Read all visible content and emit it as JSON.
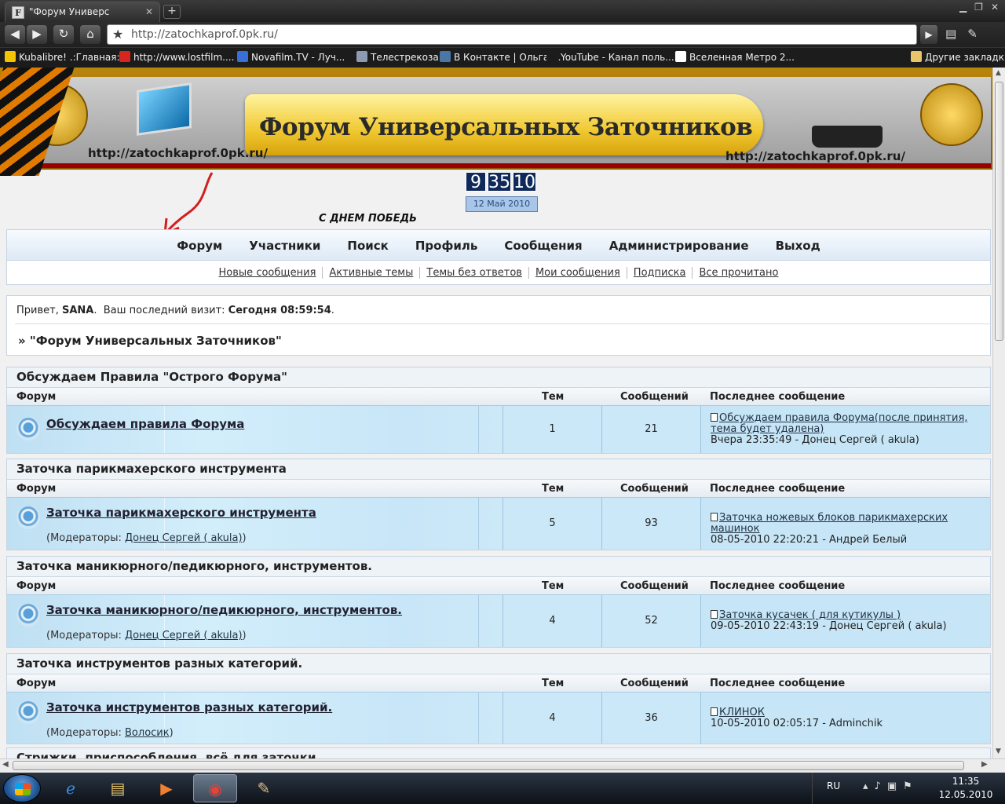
{
  "browser": {
    "tab_title": "\"Форум Универс",
    "tab_favicon": "F",
    "url": "http://zatochkaprof.0pk.ru/",
    "bookmarks": [
      {
        "label": "Kubalibre! .:Главная:.",
        "icon": "star-icon",
        "color": "#f5c400"
      },
      {
        "label": "http://www.lostfilm....",
        "icon": "lf-icon",
        "color": "#d7261e"
      },
      {
        "label": "Novafilm.TV - Луч...",
        "icon": "film-icon",
        "color": "#3a6fd8"
      },
      {
        "label": "Телестрекоза",
        "icon": "tv-icon",
        "color": "#8c9bb0"
      },
      {
        "label": "В Контакте | Ольга ...",
        "icon": "vk-icon",
        "color": "#4b76a8"
      },
      {
        "label": "YouTube - Канал поль...",
        "icon": "youtube-icon",
        "color": "#1c1c1c"
      },
      {
        "label": "Вселенная Метро 2...",
        "icon": "page-icon",
        "color": "#ffffff"
      }
    ],
    "other_bookmarks": "Другие закладки"
  },
  "banner": {
    "title": "Форум Универсальных Заточников",
    "url_left": "http://zatochkaprof.0pk.ru/",
    "url_right": "http://zatochkaprof.0pk.ru/"
  },
  "clock": {
    "digits": [
      "9",
      "35",
      "10"
    ],
    "date": "12 Май 2010"
  },
  "greeting_banner": "С ДНЕМ ПОБЕДЬ",
  "nav": {
    "main": [
      "Форум",
      "Участники",
      "Поиск",
      "Профиль",
      "Сообщения",
      "Администрирование",
      "Выход"
    ],
    "sub": [
      "Новые сообщения",
      "Активные темы",
      "Темы без ответов",
      "Мои сообщения",
      "Подписка",
      "Все прочитано"
    ]
  },
  "welcome": {
    "hello": "Привет,",
    "user": "SANA",
    "last_visit_label": "Ваш последний визит:",
    "last_visit_value": "Сегодня 08:59:54",
    "breadcrumb": "» \"Форум Универсальных Заточников\""
  },
  "table_headers": {
    "forum": "Форум",
    "topics": "Тем",
    "posts": "Сообщений",
    "last": "Последнее сообщение"
  },
  "moderators_label": "(Модераторы:",
  "categories": [
    {
      "title": "Обсуждаем Правила \"Острого Форума\"",
      "forum": "Обсуждаем правила Форума",
      "moderator": "",
      "topics": "1",
      "posts": "21",
      "last_topic": "Обсуждаем правила Форума(после принятия, тема будет удалена)",
      "last_meta": "Вчера 23:35:49 - Донец Сергей ( akula)"
    },
    {
      "title": "Заточка парикмахерского инструмента",
      "forum": "Заточка парикмахерского инструмента",
      "moderator": "Донец Сергей ( akula)",
      "topics": "5",
      "posts": "93",
      "last_topic": "Заточка ножевых блоков парикмахерских машинок",
      "last_meta": "08-05-2010 22:20:21 - Андрей Белый"
    },
    {
      "title": "Заточка маникюрного/педикюрного, инструментов.",
      "forum": "Заточка маникюрного/педикюрного, инструментов.",
      "moderator": "Донец Сергей ( akula)",
      "topics": "4",
      "posts": "52",
      "last_topic": "Заточка кусачек ( для кутикулы )",
      "last_meta": "09-05-2010 22:43:19 - Донец Сергей ( akula)"
    },
    {
      "title": "Заточка инструментов разных категорий.",
      "forum": "Заточка инструментов разных категорий.",
      "moderator": "Волосик",
      "topics": "4",
      "posts": "36",
      "last_topic": "КЛИНОК",
      "last_meta": "10-05-2010 02:05:17 - Adminchik"
    }
  ],
  "partial_category": "Стрижки, приспособления, всё для заточки...",
  "taskbar": {
    "lang": "RU",
    "time": "11:35",
    "date": "12.05.2010"
  }
}
